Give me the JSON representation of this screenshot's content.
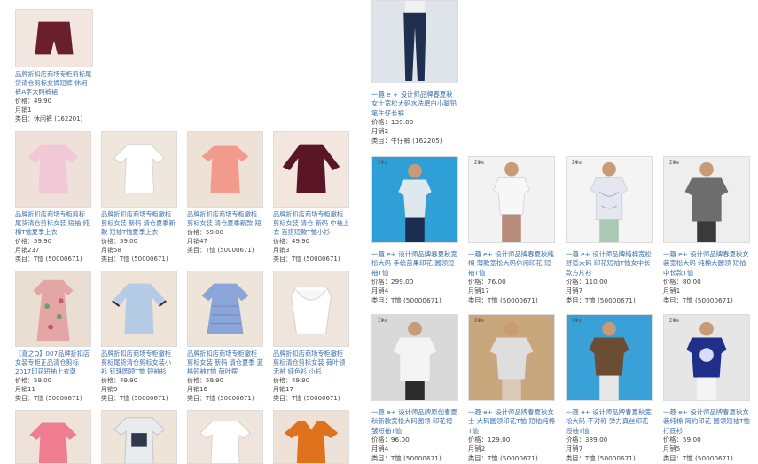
{
  "left_products": [
    {
      "title": "品牌折扣店商场专柜剪标尾货清仓剪标女裤短裤 休闲裤A字大码裤裙",
      "price": "价格：49.90",
      "sales": "月销1",
      "category": "类目：休闲裤 (162201)",
      "image": "shorts-burgundy",
      "bg": "#f3e6e0",
      "garment": "#6a1f2c"
    },
    {
      "title": "品牌折扣店商场专柜剪标尾货清仓剪标女装 短袖 纯棉T恤夏季上衣",
      "price": "价格：59.90",
      "sales": "月销237",
      "category": "类目：T恤 (50000671)",
      "image": "tee-pink",
      "bg": "#efe1d9",
      "garment": "#f3c8d6"
    },
    {
      "title": "品牌折扣店商场专柜撤柜剪标女装 新码 清仓夏季新款 短袖T恤夏季上衣",
      "price": "价格：59.00",
      "sales": "月销58",
      "category": "类目：T恤 (50000671)",
      "image": "tee-white-lace",
      "bg": "#efe6dc",
      "garment": "#ffffff"
    },
    {
      "title": "品牌折扣店商场专柜撤柜剪标女装 清仓夏季新款 短袖T恤夏季上衣",
      "price": "价格：59.00",
      "sales": "月销47",
      "category": "类目：T恤 (50000671)",
      "image": "tee-coral",
      "bg": "#eee1d6",
      "garment": "#f29a8c"
    },
    {
      "title": "品牌折扣店商场专柜撤柜剪标女装 清仓 新码 中袖上衣 百搭短款T恤小衫",
      "price": "价格：49.90",
      "sales": "月销3",
      "category": "类目：T恤 (50000671)",
      "image": "top-burgundy",
      "bg": "#f2e6df",
      "garment": "#5a1626"
    },
    {
      "title": "【喜之Q】007品牌折扣店女装专柜正品清仓剪标2017印花短袖上衣潮",
      "price": "价格：59.00",
      "sales": "月销11",
      "category": "类目：T恤 (50000671)",
      "image": "floral-dress",
      "bg": "#eaded3",
      "garment": "#e3a6a4"
    },
    {
      "title": "品牌折扣店商场专柜撤柜剪标尾货清仓剪标女装小衫 钉珠圆领T恤 短袖衫",
      "price": "价格：49.90",
      "sales": "月销9",
      "category": "类目：T恤 (50000671)",
      "image": "tee-light-blue",
      "bg": "#efe3d8",
      "garment": "#b6cbe6"
    },
    {
      "title": "品牌折扣店商场专柜撤柜剪标女装 新码 清仓夏季 蓝格短袖T恤 荷叶摆",
      "price": "价格：59.90",
      "sales": "月销16",
      "category": "类目：T恤 (50000671)",
      "image": "tee-blue-check",
      "bg": "#efe4da",
      "garment": "#8aa6d8"
    },
    {
      "title": "品牌折扣店商场专柜撤柜剪标清仓剪标女装 荷叶领无袖 纯色衫 小衫",
      "price": "价格：49.90",
      "sales": "月销17",
      "category": "类目：T恤 (50000671)",
      "image": "top-white-ruffle",
      "bg": "#efe5dc",
      "garment": "#ffffff"
    },
    {
      "title": "",
      "price": "",
      "sales": "",
      "category": "",
      "image": "tee-pink-stripe",
      "bg": "#eee2d9",
      "garment": "#ef7d8f"
    },
    {
      "title": "",
      "price": "",
      "sales": "",
      "category": "",
      "image": "tee-print",
      "bg": "#eee4d8",
      "garment": "#e9ecef"
    },
    {
      "title": "",
      "price": "",
      "sales": "",
      "category": "",
      "image": "tee-white",
      "bg": "#efe5dc",
      "garment": "#ffffff"
    },
    {
      "title": "",
      "price": "",
      "sales": "",
      "category": "",
      "image": "top-orange",
      "bg": "#eee2d8",
      "garment": "#e0721e"
    }
  ],
  "right_top": {
    "title": "一趣 e + 设计师品牌春夏秋女士宽松大码水洗磨白小脚铅笔牛仔长裤",
    "price": "价格：139.00",
    "sales": "月销2",
    "category": "类目：牛仔裤 (162205)",
    "image": "jeans-model",
    "bg": "#dfe4ea",
    "garment": "#1f2f4f"
  },
  "right_products": [
    {
      "title": "一趣 e+ 设计师品牌春夏秋宽松大码 手绘蓝果印花 圆领短袖T恤",
      "price": "价格：299.00",
      "sales": "月销4",
      "category": "类目：T恤 (50000671)",
      "image": "model-blue-print",
      "bg": "#2f9fd8",
      "garment": "#dfe8ee",
      "logo": "ΣΦ≡"
    },
    {
      "title": "一趣 e+ 设计师品牌春夏秋纯棉 薄款宽松大码休闲印花 短袖T恤",
      "price": "价格：76.00",
      "sales": "月销17",
      "category": "类目：T恤 (50000671)",
      "image": "model-white-tee",
      "bg": "#f2f2f2",
      "garment": "#f7f7f7",
      "logo": "ΣΦ≡"
    },
    {
      "title": "一趣 e+ 设计师品牌纯棉宽松舒适大码 印花短袖T恤女中长款方片衫",
      "price": "价格：110.00",
      "sales": "月销7",
      "category": "类目：T恤 (50000671)",
      "image": "model-print-tee",
      "bg": "#f4f4f4",
      "garment": "#e4e7ef",
      "logo": "ΣΦ≡"
    },
    {
      "title": "一趣 e+ 设计师品牌春夏秋女装宽松大码 纯棉大圆领 短袖中长款T恤",
      "price": "价格：80.00",
      "sales": "月销1",
      "category": "类目：T恤 (50000671)",
      "image": "model-grey-tee",
      "bg": "#eeeeee",
      "garment": "#6d6d6d",
      "logo": "ΣΦ≡"
    },
    {
      "title": "一趣 e+ 设计师品牌原创春夏秋新款宽松大码圆领 印花褶皱短袖T恤",
      "price": "价格：96.00",
      "sales": "月销4",
      "category": "类目：T恤 (50000671)",
      "image": "model-white-drape",
      "bg": "#d9d9d9",
      "garment": "#f4f4f4",
      "logo": "ΣΦ≡"
    },
    {
      "title": "一趣 e+ 设计师品牌春夏秋女士 大码圆领印花T恤 短袖纯棉T恤",
      "price": "价格：129.00",
      "sales": "月销2",
      "category": "类目：T恤 (50000671)",
      "image": "model-light-grey",
      "bg": "#c9a77c",
      "garment": "#dedede",
      "logo": "ΣΦ≡"
    },
    {
      "title": "一趣 e+ 设计师品牌春夏秋宽松大码 不对称 弹力真丝印花短袖T恤",
      "price": "价格：389.00",
      "sales": "月销7",
      "category": "类目：T恤 (50000671)",
      "image": "model-brown-top",
      "bg": "#3aa0d8",
      "garment": "#6a4d33",
      "logo": "ΣΦ≡"
    },
    {
      "title": "一趣 e+ 设计师品牌春夏秋女装纯棉 简约印花 圆领短袖T恤 打底衫",
      "price": "价格：59.00",
      "sales": "月销5",
      "category": "类目：T恤 (50000671)",
      "image": "model-navy-top",
      "bg": "#e6e6e6",
      "garment": "#1f2f8a",
      "logo": "ΣΦ≡"
    }
  ]
}
